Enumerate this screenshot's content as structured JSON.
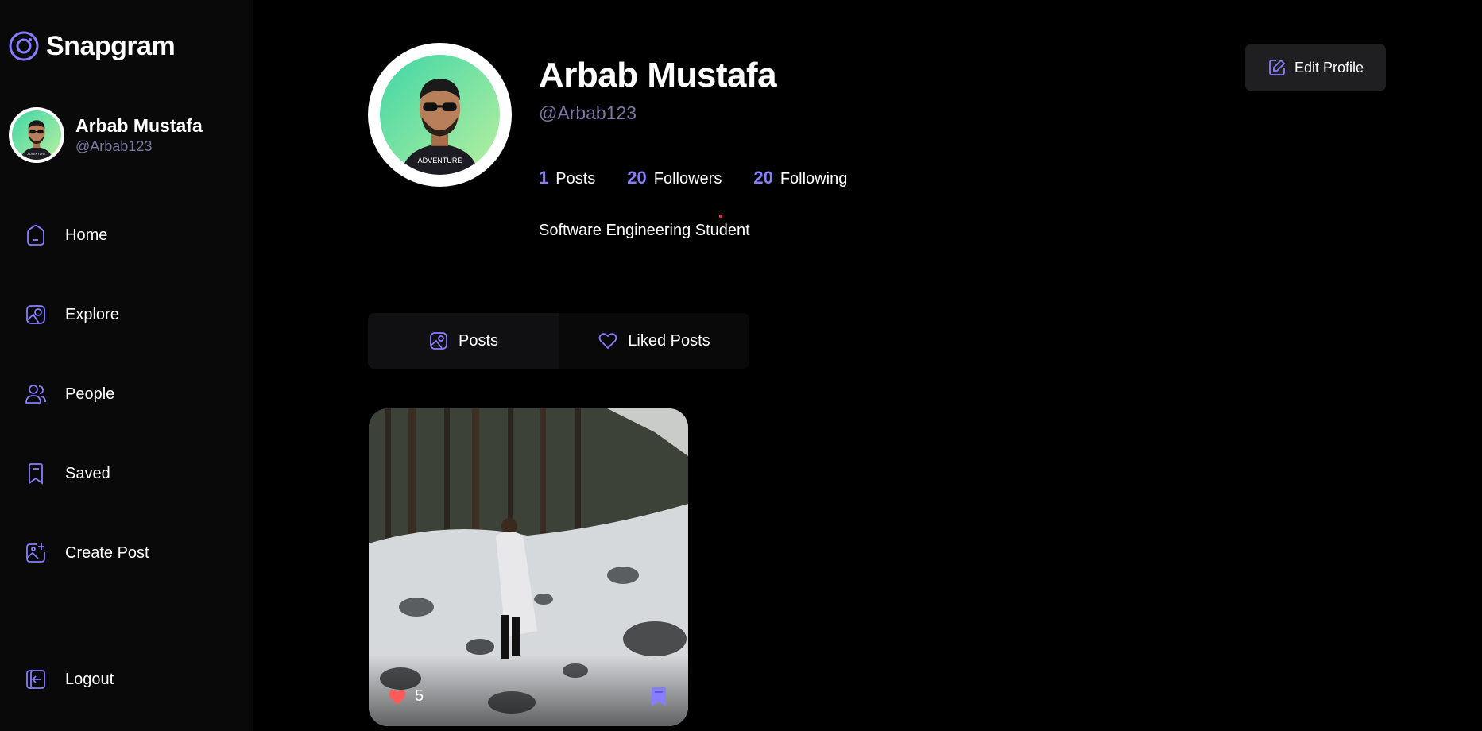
{
  "app": {
    "name": "Snapgram"
  },
  "user": {
    "name": "Arbab Mustafa",
    "handle": "@Arbab123"
  },
  "nav": [
    {
      "label": "Home",
      "icon": "home-icon"
    },
    {
      "label": "Explore",
      "icon": "explore-icon"
    },
    {
      "label": "People",
      "icon": "people-icon"
    },
    {
      "label": "Saved",
      "icon": "bookmark-icon"
    },
    {
      "label": "Create Post",
      "icon": "create-post-icon"
    }
  ],
  "logout": {
    "label": "Logout",
    "icon": "logout-icon"
  },
  "profile": {
    "name": "Arbab Mustafa",
    "handle": "@Arbab123",
    "bio": "Software Engineering Student",
    "stats": [
      {
        "value": "1",
        "label": "Posts"
      },
      {
        "value": "20",
        "label": "Followers"
      },
      {
        "value": "20",
        "label": "Following"
      }
    ],
    "edit_label": "Edit Profile"
  },
  "tabs": [
    {
      "label": "Posts",
      "icon": "image-icon",
      "active": true
    },
    {
      "label": "Liked Posts",
      "icon": "heart-icon",
      "active": false
    }
  ],
  "posts": [
    {
      "likes": "5"
    }
  ],
  "colors": {
    "accent": "#877eff",
    "muted": "#7878a3",
    "sidebar_bg": "#09090a",
    "like_red": "#ff5a5a"
  }
}
